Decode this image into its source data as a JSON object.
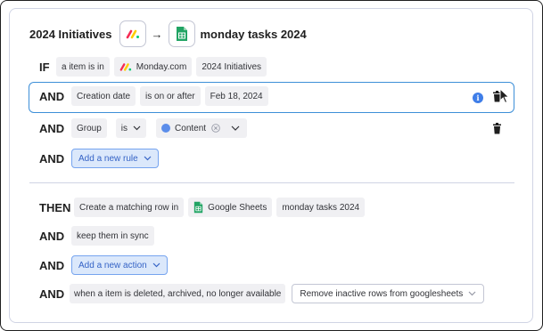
{
  "header": {
    "source_title": "2024 Initiatives",
    "arrow": "→",
    "target_title": "monday tasks 2024",
    "source_icon": "monday-logo-icon",
    "target_icon": "google-sheets-icon"
  },
  "if_row": {
    "keyword": "IF",
    "chips": [
      "a item is in",
      "Monday.com",
      "2024 Initiatives"
    ]
  },
  "and_rows": [
    {
      "keyword": "AND",
      "chips": [
        "Creation date",
        "is on or after",
        "Feb 18, 2024"
      ]
    },
    {
      "keyword": "AND",
      "field": "Group",
      "operator": "is",
      "value": "Content"
    },
    {
      "keyword": "AND",
      "button": "Add a new rule"
    }
  ],
  "then_row": {
    "keyword": "THEN",
    "chips": [
      "Create a matching row in",
      "Google Sheets",
      "monday tasks 2024"
    ]
  },
  "action_rows": [
    {
      "keyword": "AND",
      "chip": "keep them in sync"
    },
    {
      "keyword": "AND",
      "button": "Add a new action"
    },
    {
      "keyword": "AND",
      "chip": "when a item is deleted, archived, no longer available",
      "select": "Remove inactive rows from googlesheets"
    }
  ],
  "colors": {
    "accent_blue": "#3d8fd8",
    "button_bg": "#dbe8fb",
    "button_text": "#3563c6",
    "chip_bg": "#f0f0f3",
    "content_dot": "#5b8dea",
    "info_blue": "#3f7ee8"
  },
  "icons": [
    "monday-logo-icon",
    "google-sheets-icon",
    "info-icon",
    "trash-icon",
    "chevron-down-icon",
    "clear-icon",
    "mouse-cursor-icon"
  ]
}
